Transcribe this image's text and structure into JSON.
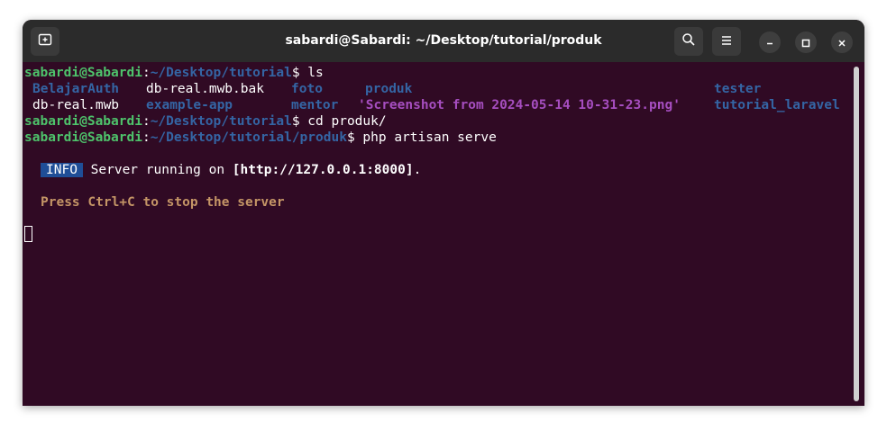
{
  "window": {
    "title": "sabardi@Sabardi: ~/Desktop/tutorial/produk"
  },
  "icons": {
    "new_tab": "new-tab-icon",
    "search": "search-icon",
    "menu": "hamburger-menu-icon",
    "minimize": "minimize-icon",
    "maximize": "maximize-icon",
    "close": "close-icon"
  },
  "terminal": {
    "prompt1": {
      "user": "sabardi@Sabardi",
      "colon": ":",
      "path": "~/Desktop/tutorial",
      "symbol": "$ ",
      "command": "ls"
    },
    "ls_row1": [
      "BelajarAuth",
      "db-real.mwb.bak",
      "foto",
      "produk",
      "tester"
    ],
    "ls_row2": [
      "db-real.mwb",
      "example-app",
      "mentor",
      "'Screenshot from 2024-05-14 10-31-23.png'",
      "tutorial_laravel"
    ],
    "prompt2": {
      "user": "sabardi@Sabardi",
      "colon": ":",
      "path": "~/Desktop/tutorial",
      "symbol": "$ ",
      "command": "cd produk/"
    },
    "prompt3": {
      "user": "sabardi@Sabardi",
      "colon": ":",
      "path": "~/Desktop/tutorial/produk",
      "symbol": "$ ",
      "command": "php artisan serve"
    },
    "info_badge": "INFO",
    "info_text_pre": " Server running on ",
    "info_url": "[http://127.0.0.1:8000]",
    "info_text_post": ".",
    "hint": "Press Ctrl+C to stop the server"
  },
  "colors": {
    "background": "#300a24",
    "user": "#4ec36b",
    "directory": "#3465a4",
    "image_file": "#a64ec0",
    "info_badge": "#1f4e97",
    "hint": "#c49566"
  }
}
